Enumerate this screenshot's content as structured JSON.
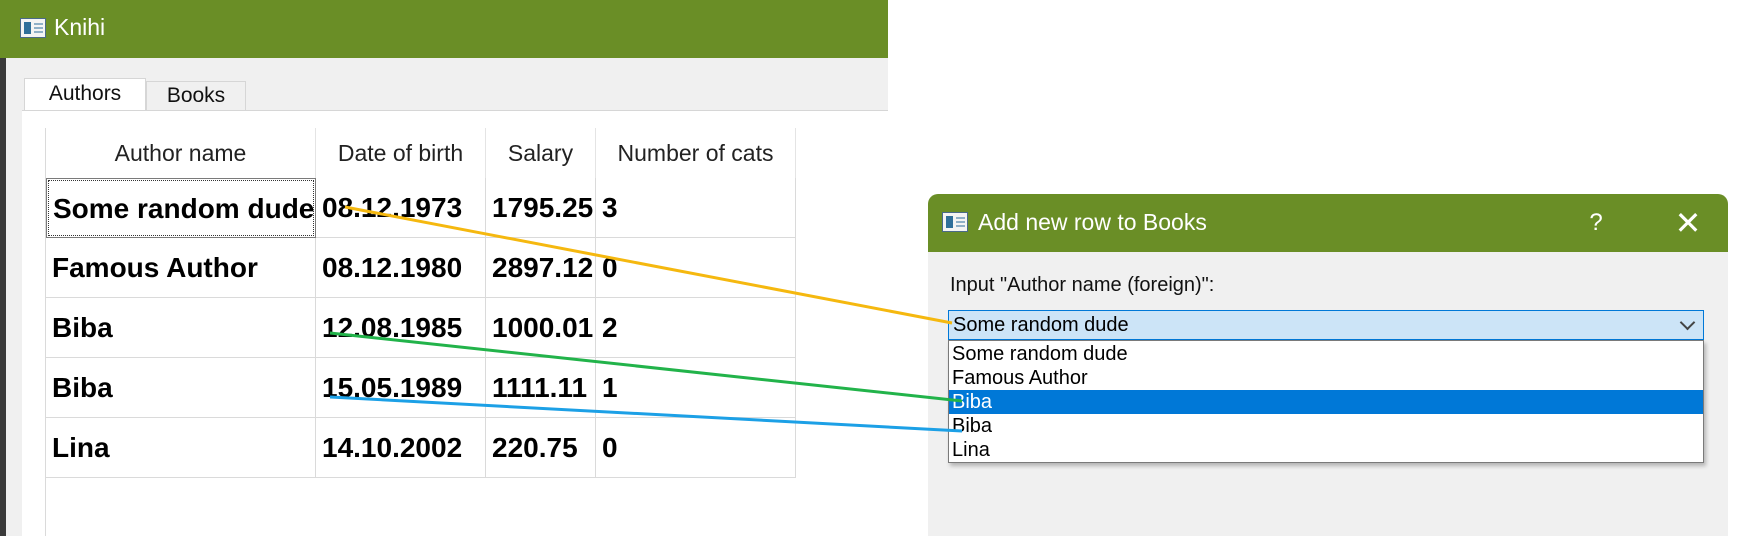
{
  "main_window": {
    "title": "Knihi",
    "tabs": [
      {
        "label": "Authors",
        "active": true
      },
      {
        "label": "Books",
        "active": false
      }
    ],
    "table": {
      "columns": [
        "Author name",
        "Date of birth",
        "Salary",
        "Number of cats"
      ],
      "rows": [
        [
          "Some random dude",
          "08.12.1973",
          "1795.25",
          "3"
        ],
        [
          "Famous Author",
          "08.12.1980",
          "2897.12",
          "0"
        ],
        [
          "Biba",
          "12.08.1985",
          "1000.01",
          "2"
        ],
        [
          "Biba",
          "15.05.1989",
          "1111.11",
          "1"
        ],
        [
          "Lina",
          "14.10.2002",
          "220.75",
          "0"
        ]
      ]
    }
  },
  "dialog": {
    "title": "Add new row to Books",
    "help_label": "?",
    "close_label": "✕",
    "field_label": "Input \"Author name (foreign)\":",
    "combo_value": "Some random dude",
    "options": [
      "Some random dude",
      "Famous Author",
      "Biba",
      "Biba",
      "Lina"
    ],
    "selected_index": 2
  },
  "colors": {
    "title_bar": "#6a8e26",
    "selection": "#0078d7",
    "connector_row1": "#f5b80f",
    "connector_row3": "#22b34a",
    "connector_row4": "#1ca0e6"
  },
  "icons": [
    "app-window-icon",
    "chevron-down-icon",
    "close-icon",
    "help-icon",
    "sort-ascending-icon"
  ]
}
